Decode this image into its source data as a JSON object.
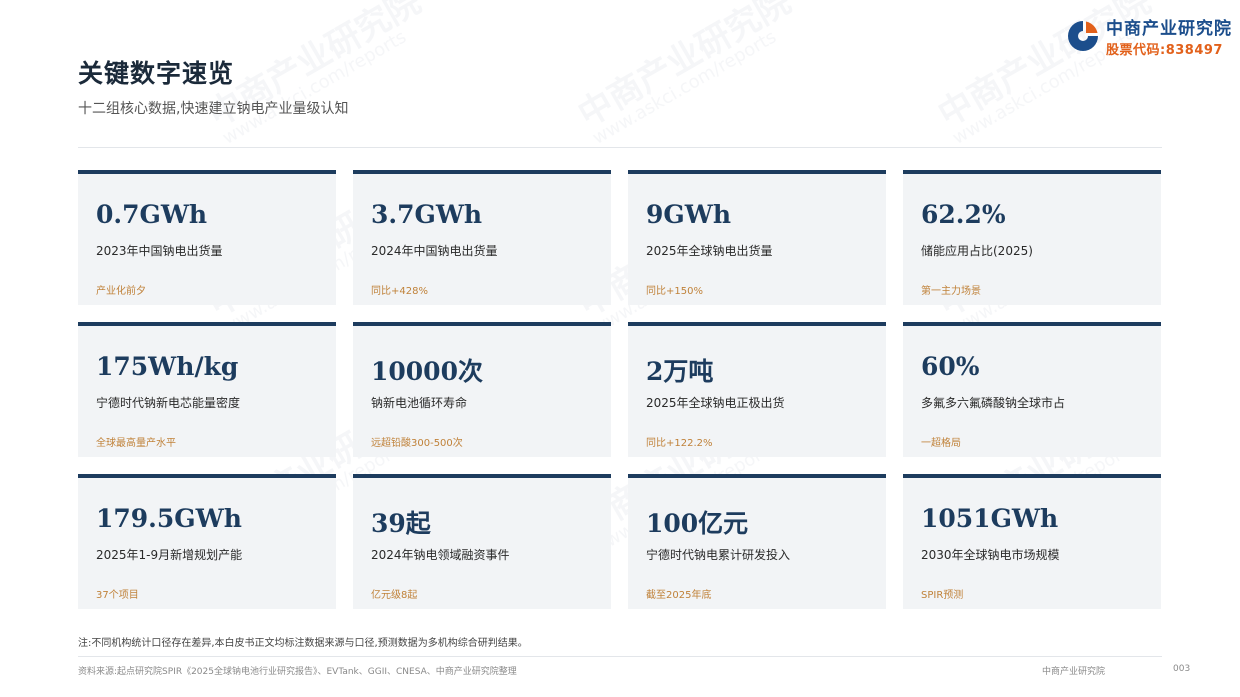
{
  "header": {
    "title": "关键数字速览",
    "subtitle": "十二组核心数据,快速建立钠电产业量级认知"
  },
  "logo": {
    "name": "中商产业研究院",
    "code": "股票代码:838497",
    "colors": {
      "blue": "#1c4e8c",
      "orange": "#e2611b"
    }
  },
  "colors": {
    "card_accent": "#1d3c5e",
    "card_bg": "#f2f4f6",
    "note_color": "#c0823a"
  },
  "cards": [
    {
      "value": "0.7GWh",
      "label": "2023年中国钠电出货量",
      "note": "产业化前夕"
    },
    {
      "value": "3.7GWh",
      "label": "2024年中国钠电出货量",
      "note": "同比+428%"
    },
    {
      "value": "9GWh",
      "label": "2025年全球钠电出货量",
      "note": "同比+150%"
    },
    {
      "value": "62.2%",
      "label": "储能应用占比(2025)",
      "note": "第一主力场景"
    },
    {
      "value": "175Wh/kg",
      "label": "宁德时代钠新电芯能量密度",
      "note": "全球最高量产水平"
    },
    {
      "value": "10000次",
      "label": "钠新电池循环寿命",
      "note": "远超铅酸300-500次"
    },
    {
      "value": "2万吨",
      "label": "2025年全球钠电正极出货",
      "note": "同比+122.2%"
    },
    {
      "value": "60%",
      "label": "多氟多六氟磷酸钠全球市占",
      "note": "一超格局"
    },
    {
      "value": "179.5GWh",
      "label": "2025年1-9月新增规划产能",
      "note": "37个项目"
    },
    {
      "value": "39起",
      "label": "2024年钠电领域融资事件",
      "note": "亿元级8起"
    },
    {
      "value": "100亿元",
      "label": "宁德时代钠电累计研发投入",
      "note": "截至2025年底"
    },
    {
      "value": "1051GWh",
      "label": "2030年全球钠电市场规模",
      "note": "SPIR预测"
    }
  ],
  "footnote": "注:不同机构统计口径存在差异,本白皮书正文均标注数据来源与口径,预测数据为多机构综合研判结果。",
  "footer": {
    "source": "资料来源:起点研究院SPIR《2025全球钠电池行业研究报告》、EVTank、GGII、CNESA、中商产业研究院整理",
    "brand": "中商产业研究院",
    "page_number": "003"
  },
  "watermark": {
    "text": "中商产业研究院",
    "url": "www.askci.com/reports"
  }
}
